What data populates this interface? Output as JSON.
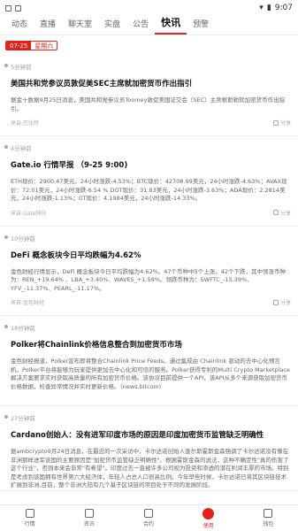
{
  "status": {
    "time": "9:07"
  },
  "tabs": [
    "动态",
    "直播",
    "聊天室",
    "实盘",
    "公告",
    "快讯",
    "预警"
  ],
  "date": {
    "time": "07-25",
    "weekday": "星期六"
  },
  "feed": [
    {
      "time": "5分钟前",
      "title": "美国共和党参议员敦促美SEC主席就加密货币作出指引",
      "body": "据金十数据9月25日消息，美国共和党参议员Toomey敦促美国证交会（SEC）主席根斯勒就加密货币作出指引。",
      "source": "来自:巴比特",
      "share": "分享"
    },
    {
      "time": "4分钟前",
      "title": "Gate.io 行情早报 （9-25 9:00)",
      "body": "ETH现价：2900.47美元，24小时涨跌-4.53%；BTC现价：42708.99美元，24小时涨跌-4.63%；AVAX现价：72.01美元，24小时涨跌-6.54 %  DOT现价：31.83美元，24小时涨跌-3.63%；ADA现价：2.2814美元，24小时涨跌-1.13%；GT现价：4.1984美元，24小时涨跌-14.33%。",
      "source": "来自:Gate快讯",
      "share": "分享"
    },
    {
      "time": "10分钟前",
      "title": "DeFi 概念板块今日平均跌幅为4.62%",
      "body": "金色财经行情显示，DeFi 概念板块今日平均跌幅为4.62%。47个币种中5个上涨，42个下跌，其中领涨币种为：REN_+19.64% 、LBA_+3.40%、WAVES_+1.59%。领跌币种为：SWFTC_-15.39%、YFV_-11.37%、PEARL_-11.17%。",
      "source": "来自:金色财经",
      "share": "分享"
    },
    {
      "time": "18分钟前",
      "title": "Polker将Chainlink价格信息整合到加密货币市场",
      "body": "金色财经报道，Polker宣布即将整合Chainlink Price Feeds。通过集成由 Chainlink 驱动的去中心化预言机，Polker平台将能够为玩家提供更加去中心化和可信的服务。Polker获得专利的Multi Crypto Marketplace解决方案要求实时获取高质量的所有加密货币价格。该协议目前提供一个API，该API从多个来源获取加密货币价格数据，检查异常情况并实时更新价格。（news.bitcoin)",
      "source": "",
      "share": ""
    },
    {
      "time": "27分钟前",
      "title": "Cardano创始人：没有进军印度市场的原因是印度加密货币监管缺乏明确性",
      "body": "据ambcrypto9月24日消息，在最近的一次采访中，卡尔达诺创始人查尔斯霍斯金森强调了卡尔达诺没有像在非洲那样进军该国的主要原因是\"加密货币监管缺乏明确性\"。根据霍斯金森的说法，这种不确定性\"真的伤害了这个行业\"，否则本来会非常\"有希望\"。印度过去一直被许多公司视为投资和渗透的潜在利润丰厚的市场。特别是考虑到该国拥有世界第六大经济体，年轻人占总人口很高比例。今年早些时候，卡尔达诺已将其区块链技术扩展到非洲,目前，整个非洲大陆有几个基于区块链的项目处于不同的发展阶段。",
      "source": "",
      "share": ""
    }
  ],
  "bottomnav": [
    "行情",
    "资讯",
    "合约",
    "使用",
    "钱包"
  ]
}
